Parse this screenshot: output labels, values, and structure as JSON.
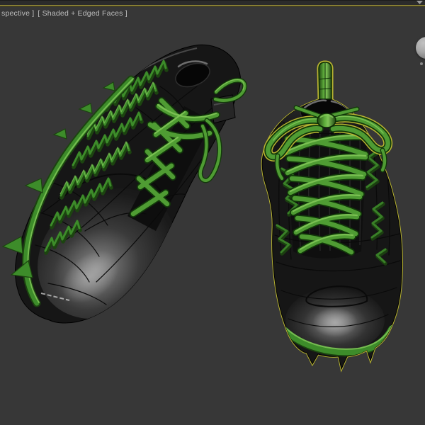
{
  "viewport": {
    "view_label": "spective ]",
    "shading_label": "[ Shaded + Edged Faces ]"
  },
  "scene": {
    "left_object": "cleat-shoe-side-top-view",
    "right_object": "cleat-shoe-front-top-view",
    "right_object_selected": true
  },
  "icons": {
    "navigation_sphere": "navigation-sphere-icon",
    "corner_mark": "viewport-corner-mark"
  },
  "colors": {
    "background": "#373737",
    "topbar": "#2b2b2b",
    "active_border": "#877e33",
    "label_text": "#bfbfbf",
    "shoe_body": "#161616",
    "wire": "#0a0a0a",
    "lace_dark": "#12380a",
    "lace_mid": "#4f9c33",
    "lace_light": "#7fc557",
    "sole_green": "#3d8c2a",
    "sole_green_dark": "#1c4410",
    "selection_yellow": "#b8b431",
    "highlight_gray": "#8f8f8f",
    "nav_sphere": "#a9a9a9",
    "collar_rim": "#6e6e6e"
  }
}
